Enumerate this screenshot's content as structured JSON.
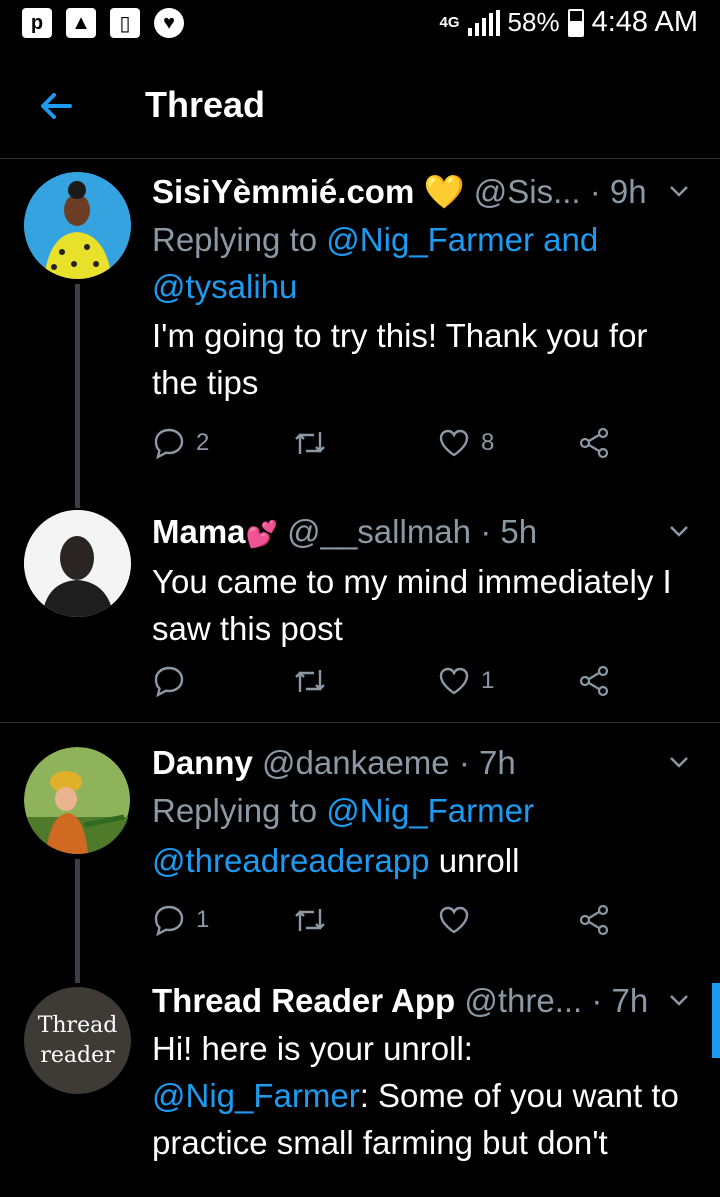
{
  "status_bar": {
    "network": "4G",
    "battery": "58%",
    "time": "4:48 AM"
  },
  "header": {
    "title": "Thread"
  },
  "tweets": [
    {
      "name": "SisiYèmmié.com",
      "emoji": "💛",
      "handle": "@Sis...",
      "time": "· 9h",
      "replying_prefix": "Replying to",
      "replying_to": "@Nig_Farmer and",
      "replying_to_2": "@tysalihu",
      "text": "I'm going to try this! Thank you for the tips",
      "replies": "2",
      "retweets": "",
      "likes": "8"
    },
    {
      "name": "Mama",
      "emoji": "💕",
      "handle": "@__sallmah",
      "time": "· 5h",
      "text": "You came to my mind immediately I saw this post",
      "replies": "",
      "retweets": "",
      "likes": "1"
    },
    {
      "name": "Danny",
      "handle": "@dankaeme",
      "time": "· 7h",
      "replying_prefix": "Replying to",
      "replying_to": "@Nig_Farmer",
      "mention": "@threadreaderapp",
      "text": " unroll",
      "replies": "1",
      "retweets": "",
      "likes": ""
    },
    {
      "name": "Thread Reader App",
      "handle": "@thre...",
      "time": "· 7h",
      "avatar_line1": "Thread",
      "avatar_line2": "reader",
      "text_line1": "Hi! here is your unroll:",
      "mention": "@Nig_Farmer",
      "text_rest": ": Some of you want to practice small farming but don't"
    }
  ],
  "colors": {
    "accent": "#1d9bf0",
    "muted": "#8b98a5",
    "background": "#000000"
  }
}
